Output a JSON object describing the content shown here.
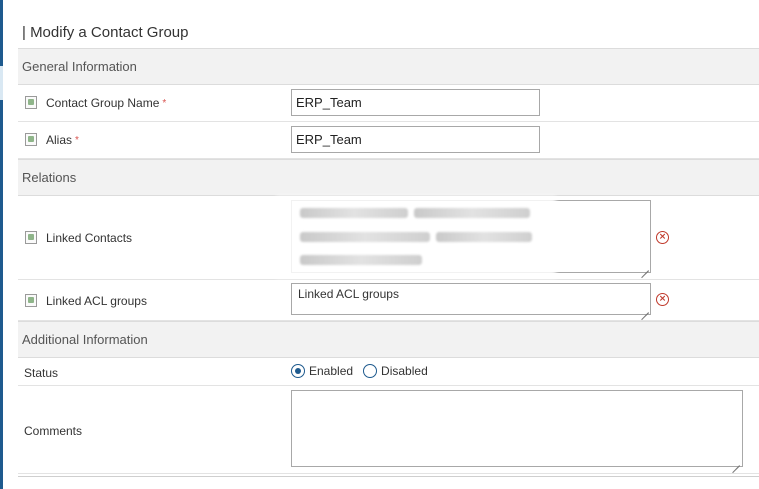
{
  "page": {
    "title": "| Modify a Contact Group"
  },
  "sections": {
    "general": "General Information",
    "relations": "Relations",
    "additional": "Additional Information"
  },
  "fields": {
    "group_name": {
      "label": "Contact Group Name",
      "required": "*",
      "value": "ERP_Team"
    },
    "alias": {
      "label": "Alias",
      "required": "*",
      "value": "ERP_Team"
    },
    "linked_contacts": {
      "label": "Linked Contacts"
    },
    "linked_acl_groups": {
      "label": "Linked ACL groups",
      "placeholder": "Linked ACL groups"
    },
    "status": {
      "label": "Status",
      "options": [
        "Enabled",
        "Disabled"
      ],
      "selected": "Enabled"
    },
    "comments": {
      "label": "Comments",
      "value": ""
    }
  },
  "icons": {
    "clear": "clear-circle-icon",
    "field": "broken-image-icon"
  },
  "colors": {
    "accent": "#1e5a8e",
    "danger": "#c0392b",
    "section_bg": "#f2f2f2"
  }
}
